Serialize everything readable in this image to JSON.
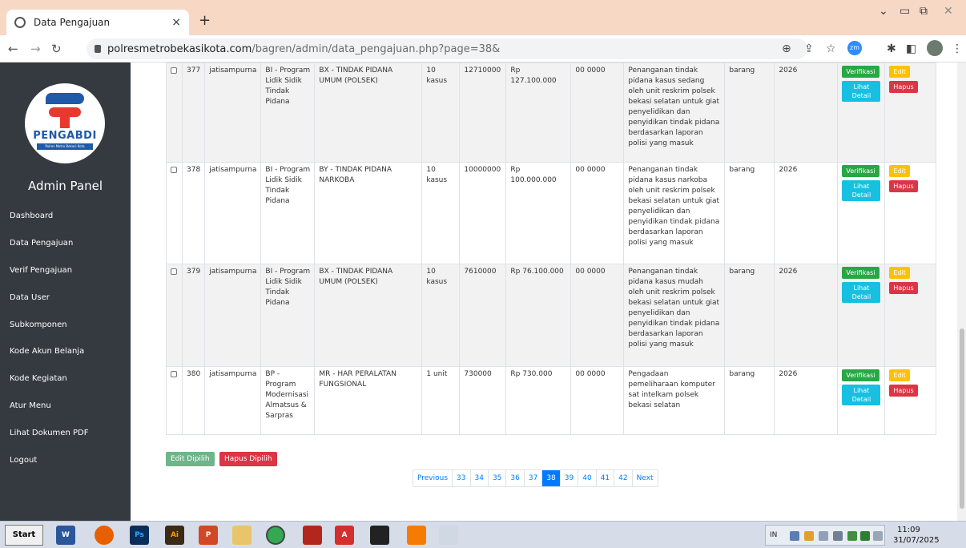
{
  "browser": {
    "tab_title": "Data Pengajuan",
    "tab_close": "×",
    "new_tab": "+",
    "url_host": "polresmetrobekasikota.com",
    "url_path": "/bagren/admin/data_pengajuan.php?page=38&"
  },
  "sidebar": {
    "logo_text": "PENGABDI",
    "logo_sub": "Polres Metro Bekasi Kota",
    "admin_title": "Admin Panel",
    "items": [
      {
        "label": "Dashboard"
      },
      {
        "label": "Data Pengajuan"
      },
      {
        "label": "Verif Pengajuan"
      },
      {
        "label": "Data User"
      },
      {
        "label": "Subkomponen"
      },
      {
        "label": "Kode Akun Belanja"
      },
      {
        "label": "Kode Kegiatan"
      },
      {
        "label": "Atur Menu"
      },
      {
        "label": "Lihat Dokumen PDF"
      },
      {
        "label": "Logout"
      }
    ]
  },
  "table": {
    "rows": [
      {
        "no": "377",
        "user": "jatisampurna",
        "program": "BI - Program Lidik Sidik Tindak Pidana",
        "kegiatan": "BX - TINDAK PIDANA UMUM (POLSEK)",
        "volume": "10 kasus",
        "harga": "12710000",
        "total": "Rp 127.100.000",
        "kode": "00 0000",
        "uraian": "Penanganan tindak pidana kasus sedang oleh unit reskrim polsek bekasi selatan untuk giat penyelidikan dan penyidikan tindak pidana berdasarkan laporan polisi yang masuk",
        "jenis": "barang",
        "tahun": "2026"
      },
      {
        "no": "378",
        "user": "jatisampurna",
        "program": "BI - Program Lidik Sidik Tindak Pidana",
        "kegiatan": "BY - TINDAK PIDANA NARKOBA",
        "volume": "10 kasus",
        "harga": "10000000",
        "total": "Rp 100.000.000",
        "kode": "00 0000",
        "uraian": "Penanganan tindak pidana kasus narkoba oleh unit reskrim polsek bekasi selatan untuk giat penyelidikan dan penyidikan tindak pidana berdasarkan laporan polisi yang masuk",
        "jenis": "barang",
        "tahun": "2026"
      },
      {
        "no": "379",
        "user": "jatisampurna",
        "program": "BI - Program Lidik Sidik Tindak Pidana",
        "kegiatan": "BX - TINDAK PIDANA UMUM (POLSEK)",
        "volume": "10 kasus",
        "harga": "7610000",
        "total": "Rp 76.100.000",
        "kode": "00 0000",
        "uraian": "Penanganan tindak pidana kasus mudah oleh unit reskrim polsek bekasi selatan untuk giat penyelidikan dan penyidikan tindak pidana berdasarkan laporan polisi yang masuk",
        "jenis": "barang",
        "tahun": "2026"
      },
      {
        "no": "380",
        "user": "jatisampurna",
        "program": "BP - Program Modernisasi Almatsus & Sarpras",
        "kegiatan": "MR - HAR PERALATAN FUNGSIONAL",
        "volume": "1 unit",
        "harga": "730000",
        "total": "Rp 730.000",
        "kode": "00 0000",
        "uraian": "Pengadaan pemeliharaan komputer sat intelkam polsek bekasi selatan",
        "jenis": "barang",
        "tahun": "2026"
      }
    ],
    "actions": {
      "verifikasi": "Verifikasi",
      "lihat_detail": "Lihat Detail",
      "edit": "Edit",
      "hapus": "Hapus"
    }
  },
  "bulk": {
    "edit_label": "Edit Dipilih",
    "delete_label": "Hapus Dipilih"
  },
  "pagination": {
    "previous": "Previous",
    "pages": [
      "33",
      "34",
      "35",
      "36",
      "37",
      "38",
      "39",
      "40",
      "41",
      "42"
    ],
    "active_page": "38",
    "next": "Next"
  },
  "taskbar": {
    "start_label": "Start",
    "lang": "IN",
    "time": "11:09",
    "date": "31/07/2025"
  }
}
